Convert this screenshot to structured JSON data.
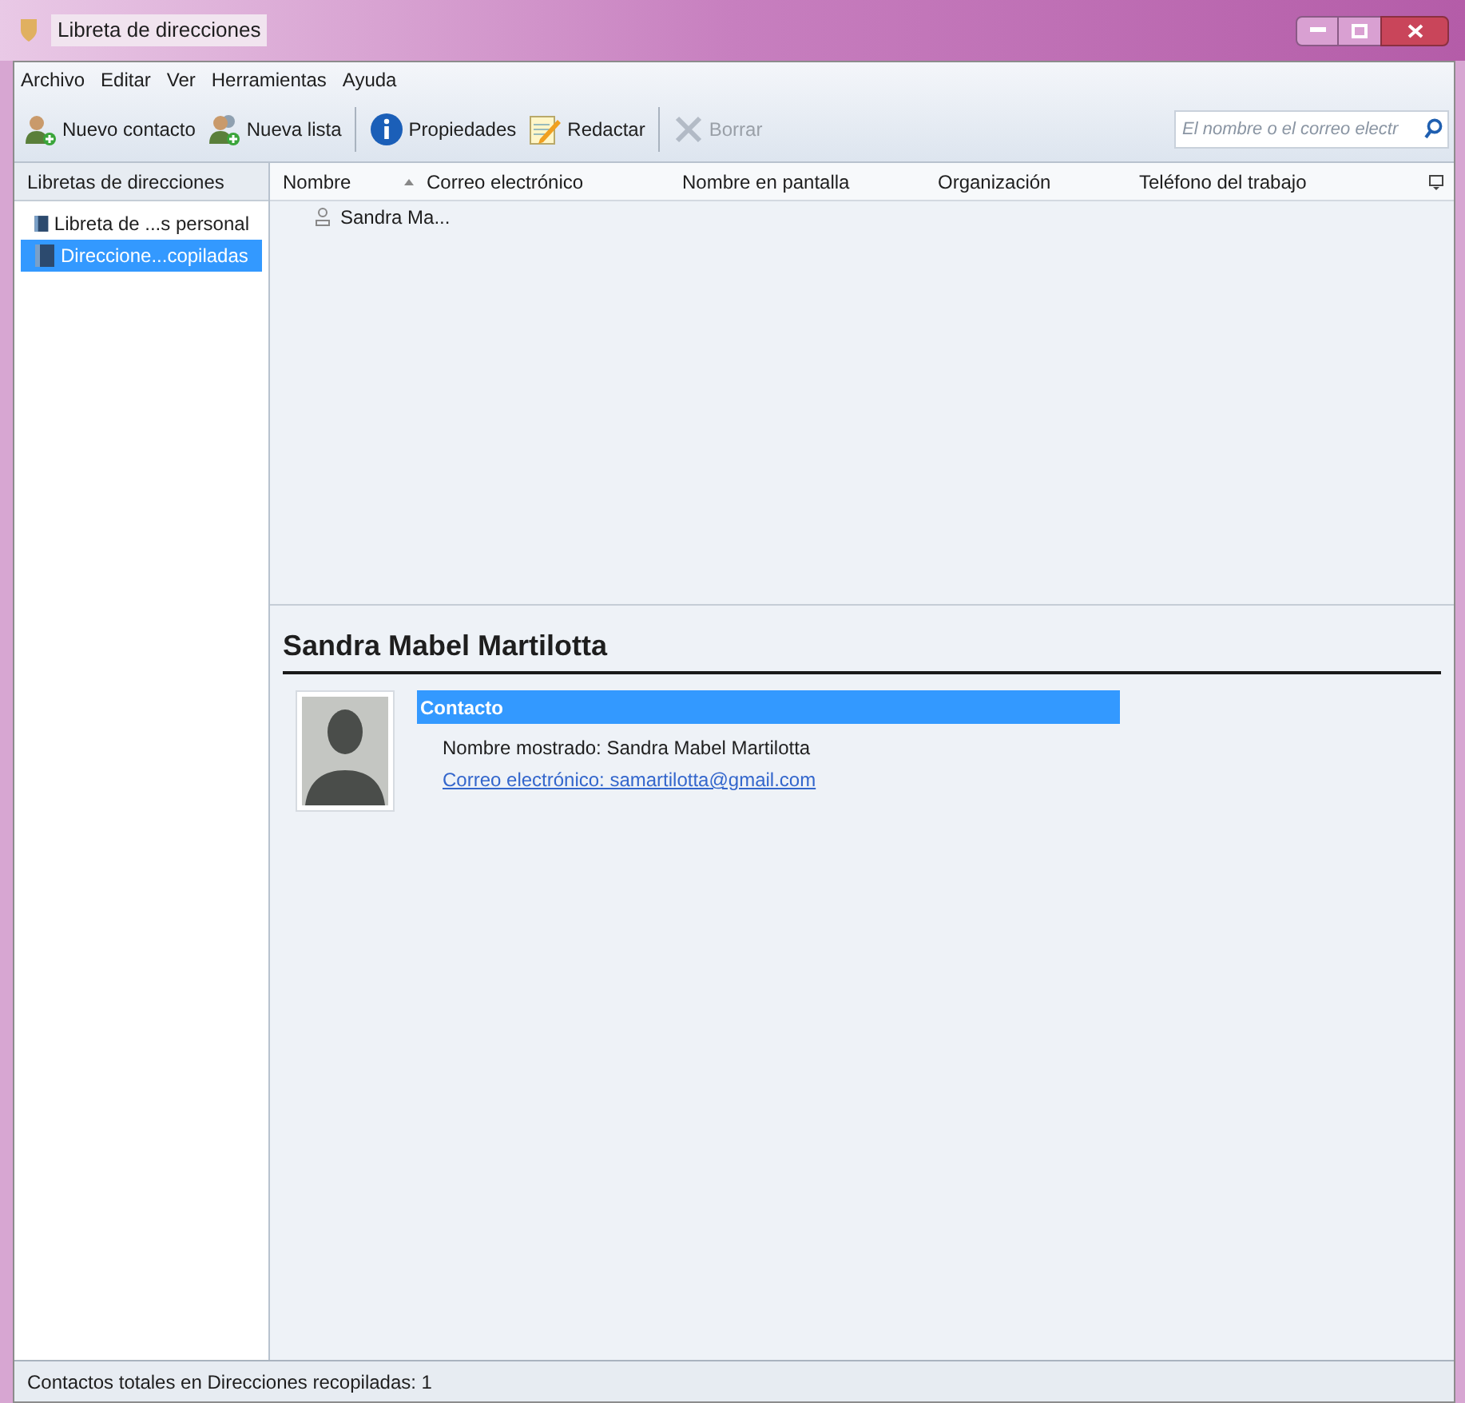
{
  "window": {
    "title": "Libreta de direcciones"
  },
  "menu": [
    "Archivo",
    "Editar",
    "Ver",
    "Herramientas",
    "Ayuda"
  ],
  "toolbar": [
    {
      "kind": "new-contact",
      "label": "Nuevo contacto",
      "disabled": false
    },
    {
      "kind": "new-list",
      "label": "Nueva lista",
      "disabled": false
    },
    {
      "kind": "separator"
    },
    {
      "kind": "properties",
      "label": "Propiedades",
      "disabled": false
    },
    {
      "kind": "compose",
      "label": "Redactar",
      "disabled": false
    },
    {
      "kind": "separator"
    },
    {
      "kind": "delete",
      "label": "Borrar",
      "disabled": true
    }
  ],
  "search": {
    "placeholder": "El nombre o el correo electr"
  },
  "sidebar": {
    "title": "Libretas de direcciones",
    "items": [
      {
        "label": "Libreta de ...s personal",
        "selected": false
      },
      {
        "label": "Direccione...copiladas",
        "selected": true
      }
    ]
  },
  "table": {
    "columns": [
      "Nombre",
      "Correo electrónico",
      "Nombre en pantalla",
      "Organización",
      "Teléfono del trabajo"
    ],
    "rows": [
      {
        "name": "Sandra Ma...",
        "selected": false
      }
    ]
  },
  "detail": {
    "name": "Sandra Mabel Martilotta",
    "section": "Contacto",
    "display_name": "Nombre mostrado: Sandra Mabel Martilotta",
    "email": "Correo electrónico: samartilotta@gmail.com"
  },
  "status_bar": "Contactos totales en Direcciones recopiladas: 1"
}
